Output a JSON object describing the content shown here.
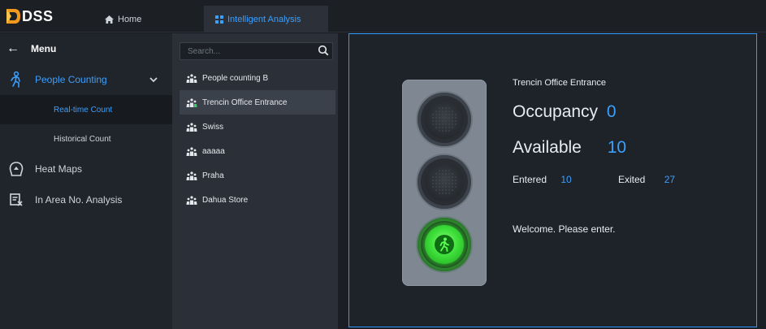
{
  "app": {
    "logo_text": "DSS"
  },
  "tabs": [
    {
      "label": "Home",
      "icon": "home-icon"
    },
    {
      "label": "Intelligent Analysis",
      "icon": "grid-icon"
    }
  ],
  "sidebar": {
    "menu_label": "Menu",
    "items": [
      {
        "label": "People Counting",
        "icon": "people-counting-icon",
        "active": true,
        "expanded": true
      },
      {
        "label": "Heat Maps",
        "icon": "heatmap-icon"
      },
      {
        "label": "In Area No. Analysis",
        "icon": "area-analysis-icon"
      }
    ],
    "sub_items": [
      {
        "label": "Real-time Count",
        "selected": true
      },
      {
        "label": "Historical Count"
      }
    ]
  },
  "device_list": {
    "search_placeholder": "Search...",
    "devices": [
      {
        "label": "People counting B"
      },
      {
        "label": "Trencin Office Entrance",
        "selected": true
      },
      {
        "label": "Swiss"
      },
      {
        "label": "aaaaa"
      },
      {
        "label": "Praha"
      },
      {
        "label": "Dahua Store"
      }
    ]
  },
  "panel": {
    "site_name": "Trencin Office Entrance",
    "occupancy_label": "Occupancy",
    "occupancy_value": "0",
    "available_label": "Available",
    "available_value": "10",
    "entered_label": "Entered",
    "entered_value": "10",
    "exited_label": "Exited",
    "exited_value": "27",
    "message": "Welcome. Please enter.",
    "light_state": "green"
  },
  "colors": {
    "accent": "#3aa0ff",
    "panel_border": "#2d9cff",
    "green_light": "#3fe03b"
  }
}
